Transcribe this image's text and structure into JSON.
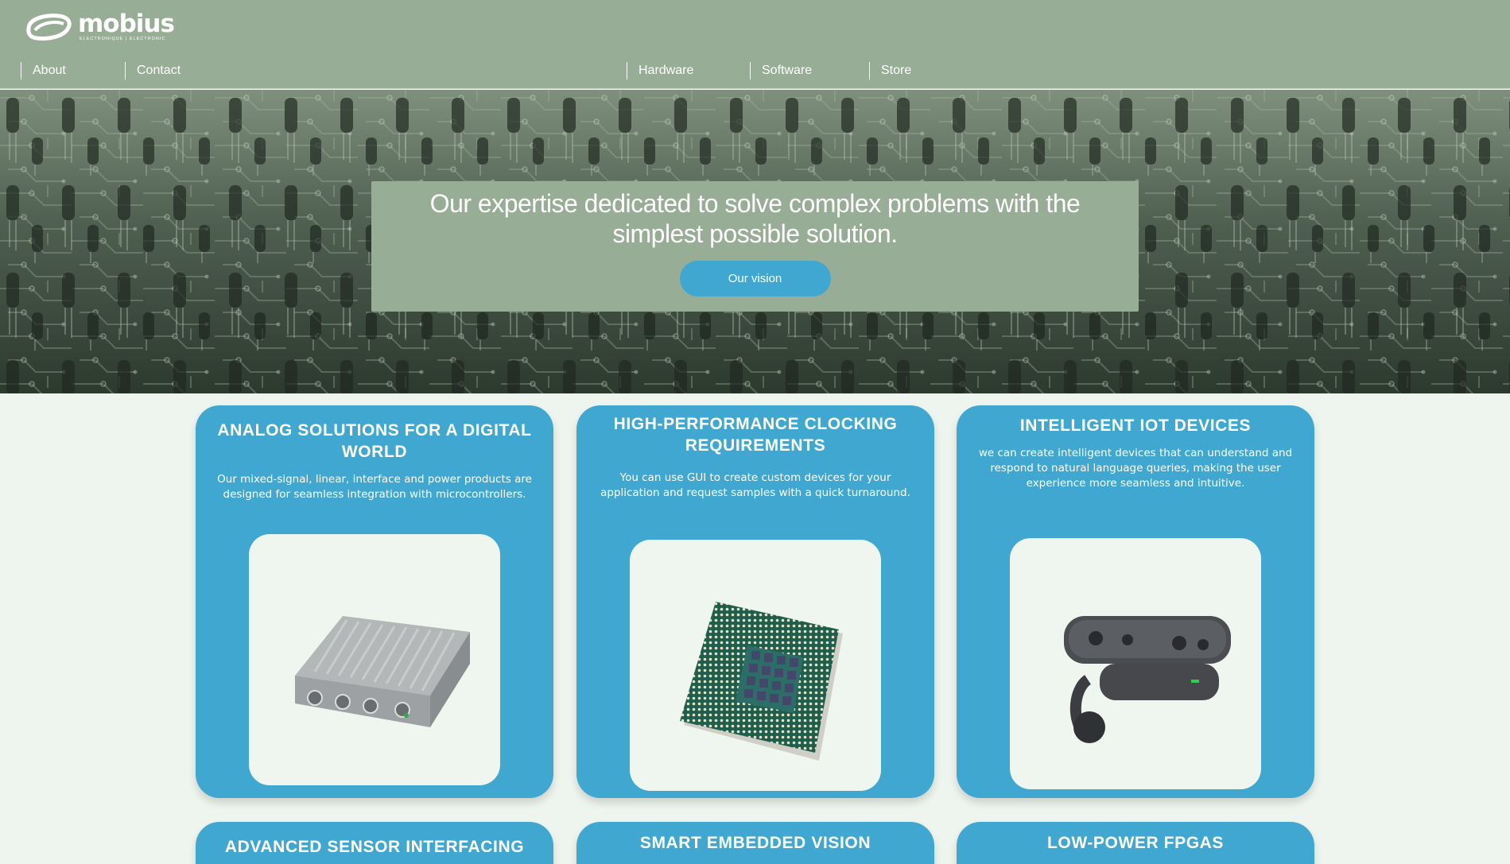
{
  "brand": {
    "name": "mobius",
    "tagline": "ELECTRONIQUE | ELECTRONIC"
  },
  "nav": {
    "left": [
      {
        "label": "About"
      },
      {
        "label": "Contact"
      }
    ],
    "right": [
      {
        "label": "Hardware"
      },
      {
        "label": "Software"
      },
      {
        "label": "Store"
      }
    ]
  },
  "hero": {
    "title": "Our expertise dedicated to solve complex problems with the simplest possible solution.",
    "button_label": "Our vision"
  },
  "cards": [
    {
      "title": "ANALOG SOLUTIONS FOR A DIGITAL WORLD",
      "description": "Our mixed-signal, linear, interface and power products are designed for seamless integration with microcontrollers.",
      "image_icon": "video-encoder-device-icon"
    },
    {
      "title": "HIGH-PERFORMANCE CLOCKING REQUIREMENTS",
      "description": "You can use GUI to create custom devices for your application and request samples with a quick turnaround.",
      "image_icon": "cpu-chip-icon"
    },
    {
      "title": "INTELLIGENT IOT DEVICES",
      "description": "we can create intelligent devices that can understand and respond to natural language queries, making the user experience more seamless and intuitive.",
      "image_icon": "depth-camera-icon"
    },
    {
      "title": "ADVANCED SENSOR INTERFACING"
    },
    {
      "title": "SMART EMBEDDED VISION"
    },
    {
      "title": "LOW-POWER FPGAS"
    }
  ],
  "colors": {
    "header_bg": "#98ad96",
    "accent_blue": "#40a8d0",
    "page_bg": "#eef5ee",
    "image_panel_bg": "#eff6ef"
  }
}
